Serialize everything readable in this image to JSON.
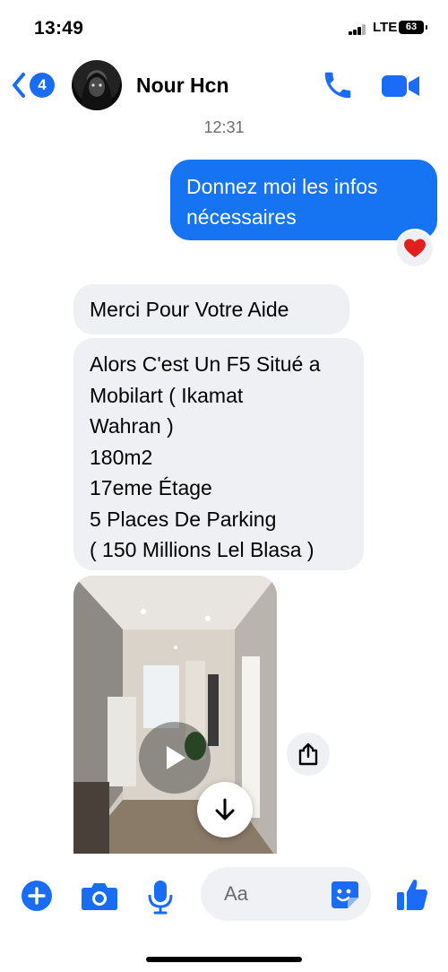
{
  "status_bar": {
    "time": "13:49",
    "network": "LTE",
    "battery": "63"
  },
  "header": {
    "back_badge": "4",
    "contact_name": "Nour Hcn"
  },
  "conversation": {
    "timestamp": "12:31",
    "outgoing": {
      "lines": [
        "Donnez moi les infos",
        "nécessaires"
      ],
      "reaction": "heart"
    },
    "incoming_1": "Merci Pour Votre Aide",
    "incoming_2": {
      "lines": [
        "Alors C'est Un F5 Situé a",
        "Mobilart ( Ikamat",
        "Wahran )",
        "180m2",
        "17eme Étage",
        "5 Places De Parking",
        "( 150 Millions Lel Blasa )"
      ]
    }
  },
  "composer": {
    "placeholder": "Aa"
  },
  "icons": {
    "back": "chevron-left-icon",
    "call": "phone-icon",
    "video": "video-camera-icon",
    "share": "share-icon",
    "play": "play-icon",
    "scroll": "arrow-down-icon",
    "add": "plus-icon",
    "camera": "camera-icon",
    "mic": "microphone-icon",
    "sticker": "sticker-icon",
    "like": "thumbs-up-icon"
  },
  "colors": {
    "accent": "#1673f2",
    "incoming_bubble": "#eff0f3",
    "reaction": "#e0201f"
  }
}
